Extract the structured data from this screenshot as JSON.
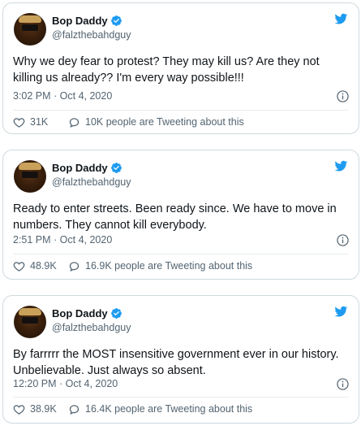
{
  "colors": {
    "twitter_blue": "#1d9bf0",
    "text": "#0f1419",
    "muted": "#536471",
    "border": "#cfd9de"
  },
  "tweets": [
    {
      "author_name": "Bop Daddy",
      "author_handle": "@falzthebahdguy",
      "text": "Why we dey fear to protest? They may kill us? Are they not killing us already?? I'm every way possible!!!",
      "timestamp": "3:02 PM · Oct 4, 2020",
      "likes": "31K",
      "people_tweeting": "10K people are Tweeting about this"
    },
    {
      "author_name": "Bop Daddy",
      "author_handle": "@falzthebahdguy",
      "text": "Ready to enter streets. Been ready since. We have to move in numbers. They cannot kill everybody.",
      "timestamp": "2:51 PM · Oct 4, 2020",
      "likes": "48.9K",
      "people_tweeting": "16.9K people are Tweeting about this"
    },
    {
      "author_name": "Bop Daddy",
      "author_handle": "@falzthebahdguy",
      "text": "By farrrrr the MOST insensitive government ever in our history. Unbelievable. Just always so absent.",
      "timestamp": "12:20 PM · Oct 4, 2020",
      "likes": "38.9K",
      "people_tweeting": "16.4K people are Tweeting about this"
    }
  ],
  "icons": {
    "verified": "verified-badge-icon",
    "bird": "twitter-bird-icon",
    "info": "info-icon",
    "like": "heart-icon",
    "reply": "speech-bubble-icon"
  }
}
